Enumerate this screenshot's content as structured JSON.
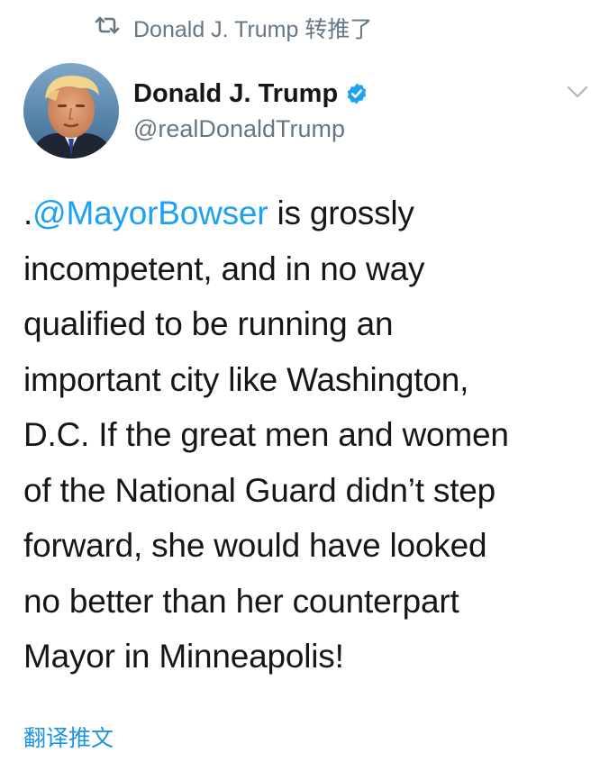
{
  "retweet": {
    "icon": "retweet-icon",
    "text": "Donald J. Trump 转推了"
  },
  "author": {
    "avatar": "avatar-photo",
    "display_name": "Donald J. Trump",
    "verified_icon": "verified-badge-icon",
    "handle": "@realDonaldTrump"
  },
  "menu_icon": "chevron-down-icon",
  "tweet": {
    "prefix": ".",
    "mention": "@MayorBowser",
    "line1_rest": " is grossly",
    "line2": "incompetent, and in no way",
    "line3": "qualified to be running an",
    "line4": "important city like Washington,",
    "line5": "D.C. If the great men and women",
    "line6": "of the National Guard didn’t step",
    "line7": "forward, she would have looked",
    "line8": "no better than her counterpart",
    "line9": "Mayor in Minneapolis!"
  },
  "translate_label": "翻译推文",
  "colors": {
    "link": "#1da1f2",
    "secondary_text": "#657786",
    "primary_text": "#14171a",
    "verified": "#1da1f2"
  }
}
